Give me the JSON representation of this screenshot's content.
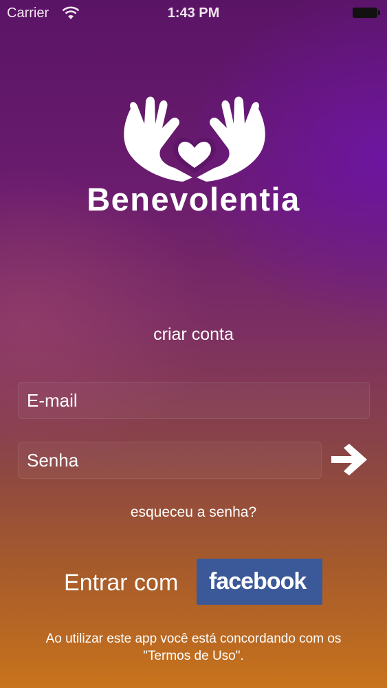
{
  "status_bar": {
    "carrier": "Carrier",
    "time": "1:43 PM"
  },
  "logo": {
    "name": "Benevolentia",
    "icon": "hands-heart-icon"
  },
  "create_account": "criar conta",
  "login_form": {
    "email_placeholder": "E-mail",
    "password_placeholder": "Senha",
    "submit_icon": "arrow-right-icon"
  },
  "forgot_password": "esqueceu a senha?",
  "facebook_login": {
    "prefix": "Entrar com",
    "button_label": "facebook",
    "button_color": "#3b5998"
  },
  "terms": {
    "line1": "Ao utilizar este app você está concordando com os",
    "line2": "\"Termos de Uso\"."
  }
}
